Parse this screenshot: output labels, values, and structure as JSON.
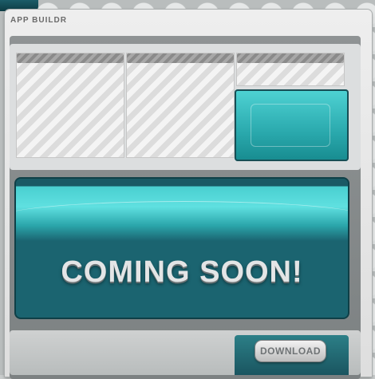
{
  "window": {
    "tab_label": "APP BUILDR"
  },
  "hero": {
    "message": "COMING SOON!"
  },
  "actions": {
    "download_label": "DOWNLOAD"
  },
  "colors": {
    "accent_teal": "#2aa9ad",
    "hero_dark": "#1b6470",
    "panel_light": "#eeeeee"
  },
  "icons": [
    "logo-mark"
  ]
}
